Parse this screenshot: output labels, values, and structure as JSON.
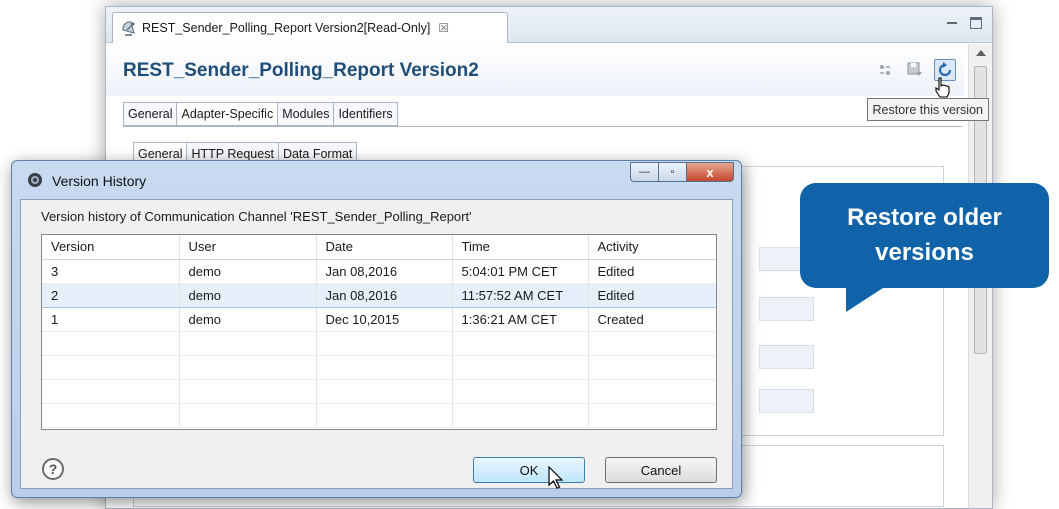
{
  "editor": {
    "tab_title": "REST_Sender_Polling_Report Version2[Read-Only]",
    "tab_close": "☒",
    "header_title": "REST_Sender_Polling_Report Version2",
    "tooltip": "Restore this version",
    "tabs": [
      {
        "label": "General",
        "active": false
      },
      {
        "label": "Adapter-Specific",
        "active": true
      },
      {
        "label": "Modules",
        "active": false
      },
      {
        "label": "Identifiers",
        "active": false
      }
    ],
    "subtabs": [
      {
        "label": "General",
        "active": true
      },
      {
        "label": "HTTP Request",
        "active": false
      },
      {
        "label": "Data Format",
        "active": false
      }
    ]
  },
  "callout": {
    "text": "Restore older versions",
    "color": "#1063a8"
  },
  "dialog": {
    "title": "Version History",
    "description": "Version history of Communication Channel 'REST_Sender_Polling_Report'",
    "columns": [
      "Version",
      "User",
      "Date",
      "Time",
      "Activity"
    ],
    "rows": [
      {
        "version": "3",
        "user": "demo",
        "date": "Jan 08,2016",
        "time": "5:04:01 PM CET",
        "activity": "Edited",
        "selected": false
      },
      {
        "version": "2",
        "user": "demo",
        "date": "Jan 08,2016",
        "time": "11:57:52 AM CET",
        "activity": "Edited",
        "selected": true
      },
      {
        "version": "1",
        "user": "demo",
        "date": "Dec 10,2015",
        "time": "1:36:21 AM CET",
        "activity": "Created",
        "selected": false
      }
    ],
    "ok_label": "OK",
    "cancel_label": "Cancel",
    "help_symbol": "?",
    "minimize_symbol": "—",
    "maximize_symbol": "▫",
    "close_symbol": "x"
  },
  "icons": {
    "editor_tab": "satellite-dish-icon",
    "header": [
      "compare-icon",
      "save-icon",
      "restore-version-icon"
    ],
    "dialog": "gear-icon"
  }
}
